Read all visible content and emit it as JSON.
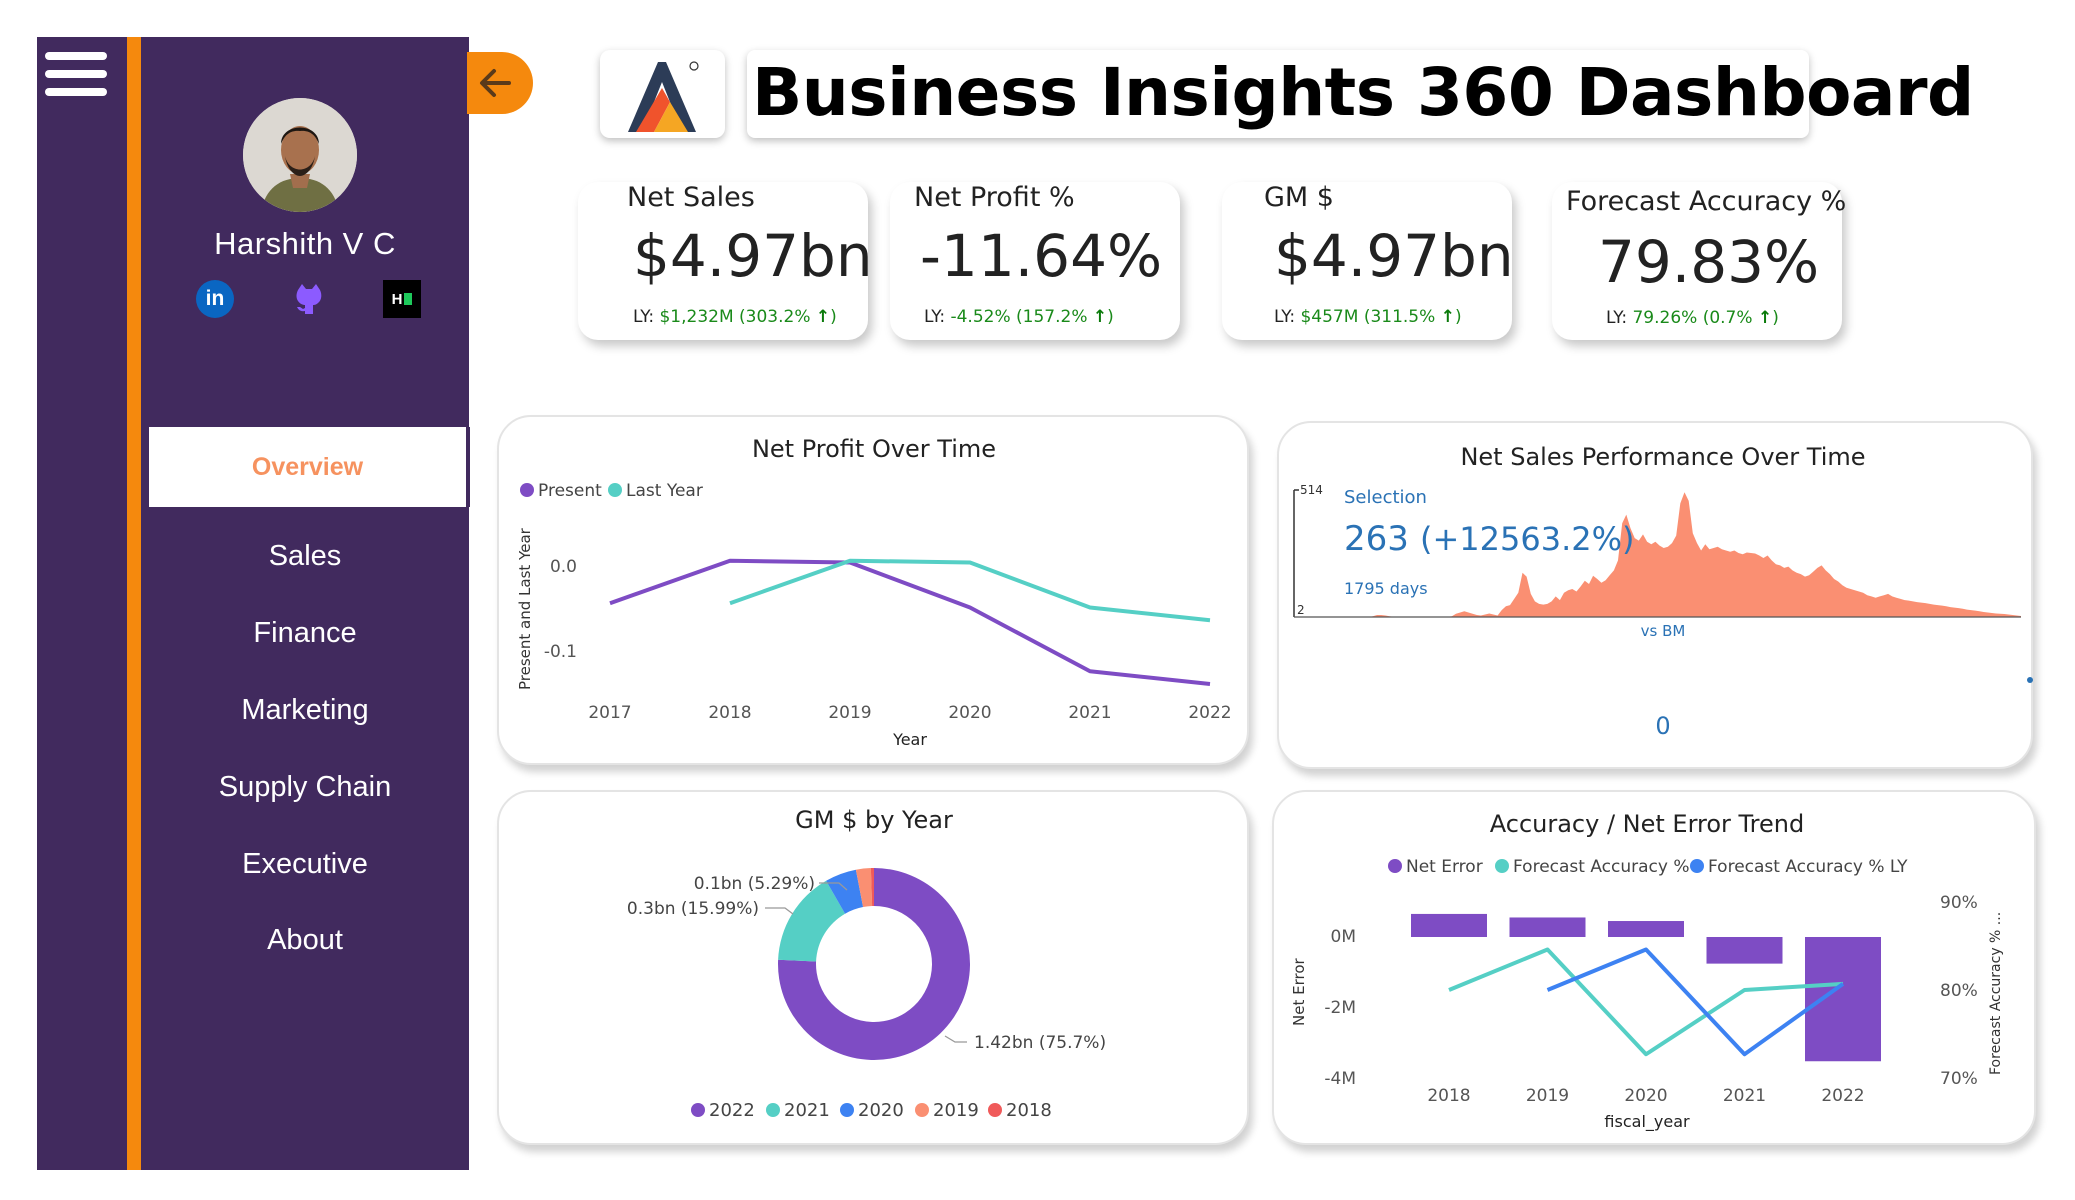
{
  "header": {
    "title": "Business Insights 360 Dashboard"
  },
  "profile": {
    "name": "Harshith V C"
  },
  "nav": {
    "active": "Overview",
    "items": [
      "Sales",
      "Finance",
      "Marketing",
      "Supply Chain",
      "Executive",
      "About"
    ]
  },
  "kpis": [
    {
      "label": "Net Sales",
      "value": "$4.97bn",
      "ly_prefix": "LY:",
      "ly_value": "$1,232M (303.2%"
    },
    {
      "label": "Net Profit %",
      "value": "-11.64%",
      "ly_prefix": "LY:",
      "ly_value": "-4.52% (157.2%"
    },
    {
      "label": "GM $",
      "value": "$4.97bn",
      "ly_prefix": "LY:",
      "ly_value": "$457M (311.5%"
    },
    {
      "label": "Forecast Accuracy %",
      "value": "79.83%",
      "ly_prefix": "LY:",
      "ly_value": "79.26% (0.7%"
    }
  ],
  "colors": {
    "sidebar": "#412a5e",
    "accent_orange": "#f5890d",
    "present": "#7e4cc4",
    "last_year": "#55cfc5",
    "area": "#fa8f72",
    "fa_ly": "#3d82f2"
  },
  "charts": {
    "net_profit": {
      "title": "Net Profit Over Time",
      "legend": [
        "Present",
        "Last Year"
      ],
      "ylabel": "Present and Last Year",
      "xlabel": "Year",
      "yticks": [
        "0.0",
        "-0.1"
      ]
    },
    "net_sales_perf": {
      "title": "Net Sales Performance Over Time",
      "selection_label": "Selection",
      "selection_value": "263",
      "selection_change": "(+12563.2%)",
      "days": "1795 days",
      "y_max_label": "514",
      "y_min_label": "2",
      "vs_label": "vs BM",
      "bottom_value": "0"
    },
    "gm_by_year": {
      "title": "GM $ by Year",
      "slice_labels": [
        "1.42bn (75.7%)",
        "0.3bn (15.99%)",
        "0.1bn (5.29%)"
      ],
      "legend": [
        "2022",
        "2021",
        "2020",
        "2019",
        "2018"
      ]
    },
    "accuracy": {
      "title": "Accuracy / Net Error Trend",
      "legend": [
        "Net Error",
        "Forecast Accuracy %",
        "Forecast Accuracy % LY"
      ],
      "ylabel_left": "Net Error",
      "ylabel_right": "Forecast Accuracy % ...",
      "xlabel": "fiscal_year",
      "left_ticks": [
        "0M",
        "-2M",
        "-4M"
      ],
      "right_ticks": [
        "90%",
        "80%",
        "70%"
      ]
    }
  },
  "chart_data": [
    {
      "type": "line",
      "title": "Net Profit Over Time",
      "xlabel": "Year",
      "ylabel": "Present and Last Year",
      "categories": [
        "2017",
        "2018",
        "2019",
        "2020",
        "2021",
        "2022"
      ],
      "ylim": [
        -0.14,
        0.03
      ],
      "series": [
        {
          "name": "Present",
          "values": [
            -0.045,
            0.005,
            0.003,
            -0.05,
            -0.125,
            -0.14
          ]
        },
        {
          "name": "Last Year",
          "values": [
            null,
            -0.045,
            0.005,
            0.003,
            -0.05,
            -0.065
          ]
        }
      ]
    },
    {
      "type": "area",
      "title": "Net Sales Performance Over Time",
      "ylim": [
        2,
        514
      ],
      "values": [
        2,
        2,
        2,
        2,
        2,
        2,
        2,
        2,
        2,
        2,
        2,
        2,
        2,
        2,
        2,
        2,
        2,
        2,
        2,
        5,
        10,
        10,
        8,
        5,
        3,
        3,
        3,
        3,
        3,
        3,
        3,
        3,
        3,
        3,
        3,
        3,
        3,
        3,
        5,
        15,
        20,
        25,
        20,
        15,
        10,
        8,
        12,
        16,
        12,
        8,
        30,
        45,
        50,
        75,
        100,
        180,
        165,
        95,
        65,
        55,
        52,
        55,
        65,
        85,
        70,
        100,
        110,
        115,
        105,
        125,
        148,
        135,
        168,
        155,
        140,
        150,
        170,
        190,
        230,
        380,
        415,
        360,
        320,
        310,
        335,
        305,
        295,
        305,
        290,
        280,
        285,
        300,
        330,
        460,
        505,
        470,
        340,
        300,
        270,
        295,
        275,
        280,
        285,
        275,
        270,
        265,
        270,
        260,
        255,
        262,
        260,
        258,
        250,
        240,
        250,
        230,
        215,
        210,
        200,
        205,
        190,
        180,
        175,
        165,
        170,
        185,
        200,
        210,
        190,
        175,
        155,
        145,
        130,
        120,
        115,
        110,
        105,
        100,
        90,
        85,
        80,
        85,
        90,
        95,
        85,
        80,
        75,
        70,
        68,
        65,
        62,
        60,
        58,
        55,
        52,
        50,
        48,
        45,
        42,
        40,
        38,
        35,
        32,
        30,
        28,
        25,
        22,
        20,
        18,
        16,
        15,
        14,
        12,
        10,
        8,
        6
      ]
    },
    {
      "type": "pie",
      "title": "GM $ by Year",
      "categories": [
        "2022",
        "2021",
        "2020",
        "2019",
        "2018"
      ],
      "values": [
        75.7,
        15.99,
        5.29,
        2.5,
        0.52
      ]
    },
    {
      "type": "bar",
      "title": "Accuracy / Net Error Trend",
      "xlabel": "fiscal_year",
      "categories": [
        "2018",
        "2019",
        "2020",
        "2021",
        "2022"
      ],
      "series": [
        {
          "name": "Net Error",
          "axis": "left",
          "unit": "M",
          "values": [
            0.65,
            0.55,
            0.45,
            -0.75,
            -3.5
          ]
        },
        {
          "name": "Forecast Accuracy %",
          "axis": "right",
          "unit": "%",
          "values": [
            80.0,
            84.6,
            72.7,
            80.0,
            80.7
          ]
        },
        {
          "name": "Forecast Accuracy % LY",
          "axis": "right",
          "unit": "%",
          "values": [
            null,
            80.0,
            84.6,
            72.7,
            80.7
          ]
        }
      ],
      "ylim_left": [
        -4.2,
        0.9
      ],
      "ylim_right": [
        69,
        91
      ]
    }
  ]
}
